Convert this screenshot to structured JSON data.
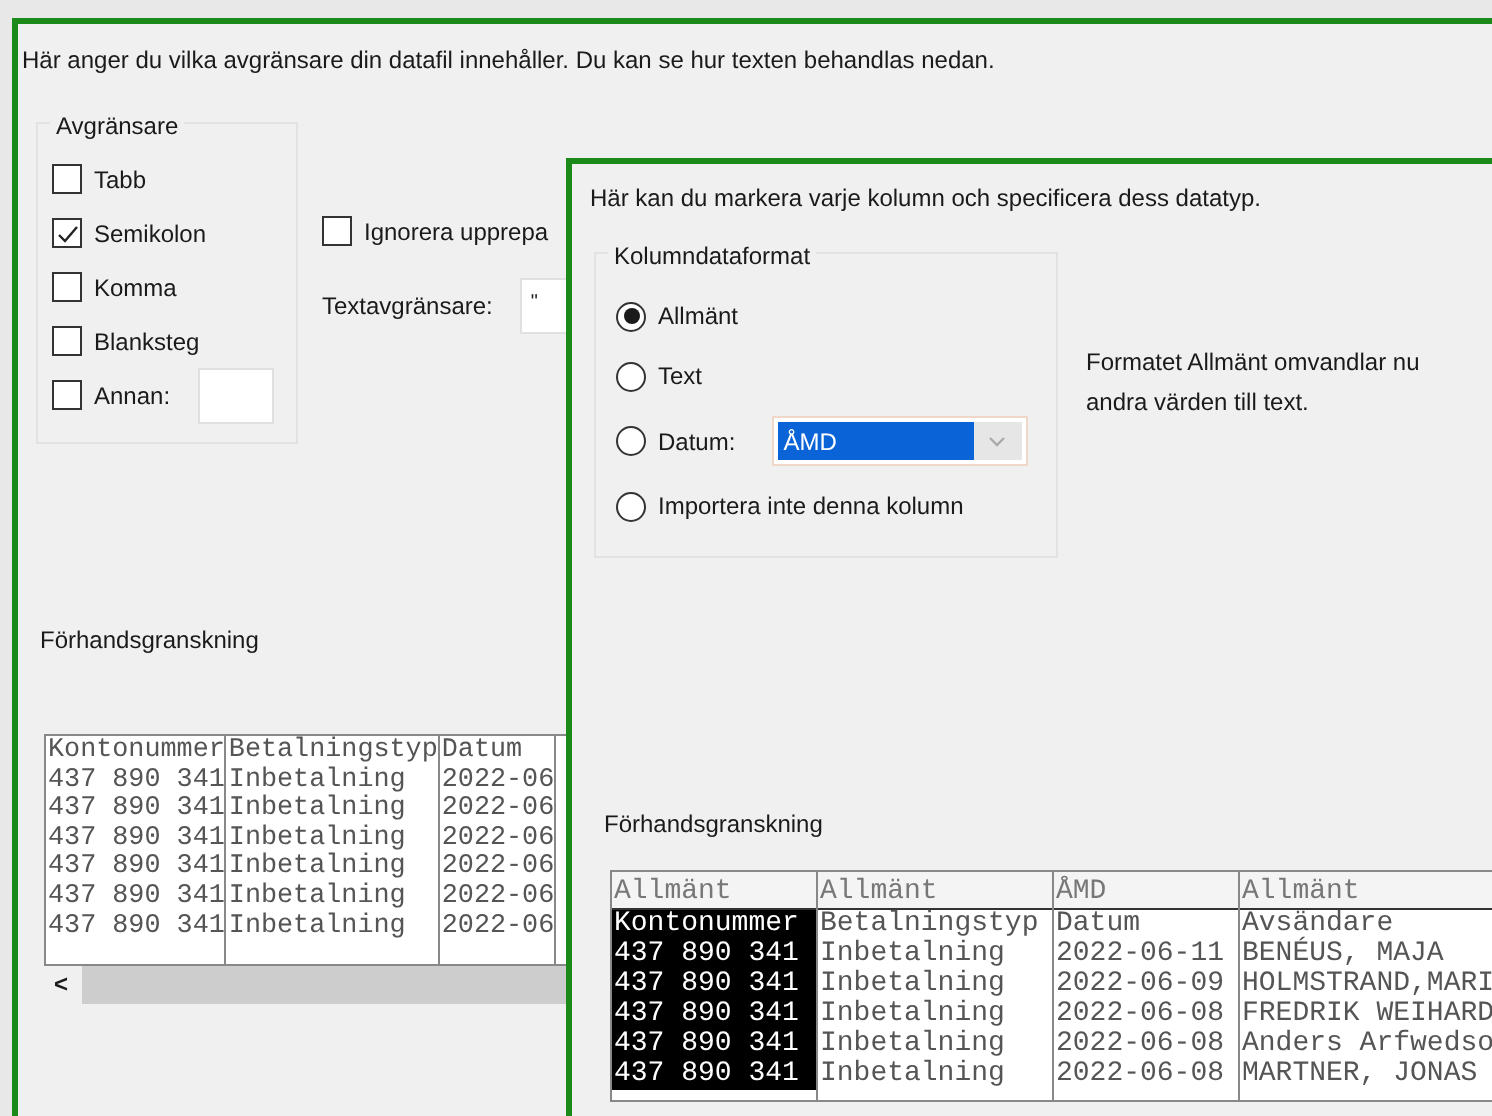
{
  "back_dialog": {
    "instruction": "Här anger du vilka avgränsare din datafil innehåller. Du kan se hur texten behandlas nedan.",
    "delimiters": {
      "title": "Avgränsare",
      "options": [
        {
          "label": "Tabb",
          "checked": false
        },
        {
          "label": "Semikolon",
          "checked": true
        },
        {
          "label": "Komma",
          "checked": false
        },
        {
          "label": "Blanksteg",
          "checked": false
        },
        {
          "label": "Annan:",
          "checked": false,
          "kind": "with-field"
        }
      ]
    },
    "ignore_consecutive": {
      "label": "Ignorera upprepa",
      "checked": false
    },
    "text_qualifier": {
      "label": "Textavgränsare:",
      "value": "\""
    },
    "preview": {
      "title": "Förhandsgranskning",
      "rows": [
        [
          "Kontonummer",
          "Betalningstyp",
          "Datum"
        ],
        [
          "437 890 341",
          "Inbetalning",
          "2022-06"
        ],
        [
          "437 890 341",
          "Inbetalning",
          "2022-06"
        ],
        [
          "437 890 341",
          "Inbetalning",
          "2022-06"
        ],
        [
          "437 890 341",
          "Inbetalning",
          "2022-06"
        ],
        [
          "437 890 341",
          "Inbetalning",
          "2022-06"
        ],
        [
          "437 890 341",
          "Inbetalning",
          "2022-06"
        ]
      ],
      "scroll_left": "<"
    }
  },
  "front_dialog": {
    "instruction": "Här kan du markera varje kolumn och specificera dess datatyp.",
    "format_group": {
      "title": "Kolumndataformat",
      "options": [
        {
          "label": "Allmänt",
          "selected": true,
          "kind": "plain"
        },
        {
          "label": "Text",
          "selected": false,
          "kind": "plain"
        },
        {
          "label": "Datum:",
          "selected": false,
          "kind": "with-select",
          "select_value": "ÅMD"
        },
        {
          "label": "Importera inte denna kolumn",
          "selected": false,
          "kind": "plain"
        }
      ]
    },
    "description_lines": [
      "Formatet Allmänt omvandlar nu",
      "andra värden till text."
    ],
    "preview": {
      "title": "Förhandsgranskning",
      "columns": [
        {
          "type": "Allmänt",
          "selected": true
        },
        {
          "type": "Allmänt",
          "selected": false
        },
        {
          "type": "ÅMD",
          "selected": false
        },
        {
          "type": "Allmänt",
          "selected": false
        }
      ],
      "rows": [
        [
          "Kontonummer",
          "Betalningstyp",
          "Datum",
          "Avsändare"
        ],
        [
          "437 890 341",
          "Inbetalning",
          "2022-06-11",
          "BENÉUS, MAJA"
        ],
        [
          "437 890 341",
          "Inbetalning",
          "2022-06-09",
          "HOLMSTRAND,MARI"
        ],
        [
          "437 890 341",
          "Inbetalning",
          "2022-06-08",
          "FREDRIK WEIHARD"
        ],
        [
          "437 890 341",
          "Inbetalning",
          "2022-06-08",
          "Anders Arfwedso"
        ],
        [
          "437 890 341",
          "Inbetalning",
          "2022-06-08",
          "MARTNER, JONAS"
        ]
      ]
    }
  }
}
